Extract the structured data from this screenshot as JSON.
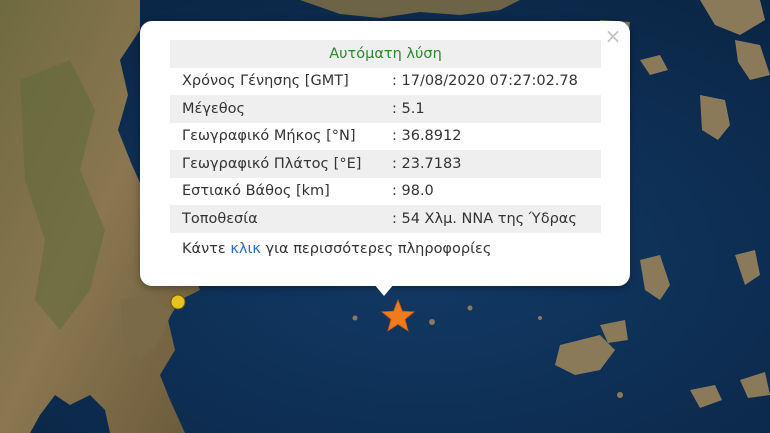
{
  "popup": {
    "title": "Αυτόματη λύση",
    "close_symbol": "×",
    "rows": [
      {
        "label": "Χρόνος Γένησης [GMT]",
        "value": ": 17/08/2020 07:27:02.78"
      },
      {
        "label": "Μέγεθος",
        "value": ": 5.1"
      },
      {
        "label": "Γεωγραφικό Μήκος [°N]",
        "value": ": 36.8912"
      },
      {
        "label": "Γεωγραφικό Πλάτος [°E]",
        "value": ": 23.7183"
      },
      {
        "label": "Εστιακό Βάθος [km]",
        "value": ": 98.0"
      },
      {
        "label": "Τοποθεσία",
        "value": ": 54 Χλμ. ΝΝΑ της Ύδρας"
      }
    ],
    "more_prefix": "Κάντε ",
    "more_link": "κλικ",
    "more_suffix": " για περισσότερες πληροφορίες"
  },
  "map": {
    "sea_color": "#0b2a4d",
    "land_color": "#7d6a45",
    "epicenter_color": "#f07a1e",
    "other_marker_color": "#e8c21e",
    "epicenter_icon": "star-icon",
    "other_marker_icon": "circle-marker-icon"
  }
}
